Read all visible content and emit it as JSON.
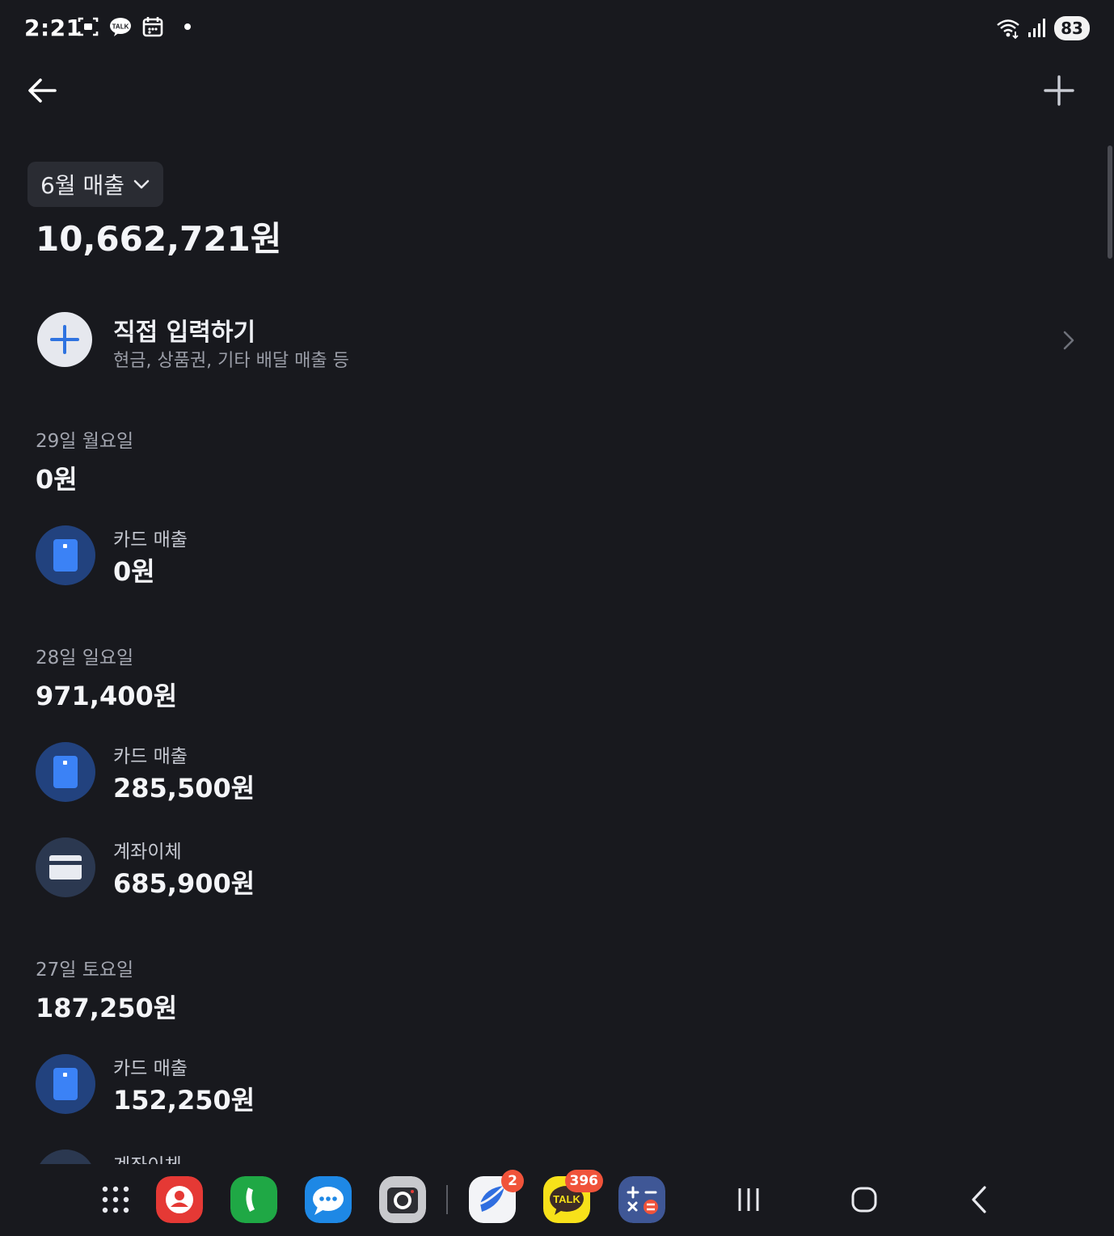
{
  "status_bar": {
    "time": "2:21",
    "left_icons": [
      "screenshot-icon",
      "kakaotalk-icon",
      "calendar-icon",
      "dot-icon"
    ],
    "right_icons": [
      "wifi-icon",
      "signal-icon"
    ],
    "battery": "83"
  },
  "header": {
    "back_icon": "arrow-left-icon",
    "add_icon": "plus-icon"
  },
  "summary": {
    "month_label": "6월 매출",
    "total": "10,662,721원"
  },
  "manual_input": {
    "title": "직접 입력하기",
    "subtitle": "현금, 상품권, 기타 배달 매출 등"
  },
  "days": [
    {
      "label": "29일 월요일",
      "total": "0원",
      "entries": [
        {
          "type": "card",
          "label": "카드 매출",
          "amount": "0원"
        }
      ]
    },
    {
      "label": "28일 일요일",
      "total": "971,400원",
      "entries": [
        {
          "type": "card",
          "label": "카드 매출",
          "amount": "285,500원"
        },
        {
          "type": "bank",
          "label": "계좌이체",
          "amount": "685,900원"
        }
      ]
    },
    {
      "label": "27일 토요일",
      "total": "187,250원",
      "entries": [
        {
          "type": "card",
          "label": "카드 매출",
          "amount": "152,250원"
        },
        {
          "type": "bank",
          "label": "계좌이체",
          "amount": ""
        }
      ]
    }
  ],
  "taskbar": {
    "apps": [
      {
        "name": "apps-grid-icon"
      },
      {
        "name": "contacts-icon",
        "color": "#e53935"
      },
      {
        "name": "phone-icon",
        "color": "#1fa845"
      },
      {
        "name": "messages-icon",
        "color": "#1e88e5"
      },
      {
        "name": "camera-icon",
        "color": "#c8c9cd"
      },
      {
        "name": "browser-icon",
        "badge": "2"
      },
      {
        "name": "kakaotalk-icon",
        "badge": "396",
        "color": "#f7e11a"
      },
      {
        "name": "calculator-icon",
        "color": "#3f5796"
      }
    ],
    "nav": [
      "recents-icon",
      "home-icon",
      "back-icon"
    ]
  },
  "colors": {
    "background": "#18191e",
    "card_icon_bg": "#22427e",
    "card_accent": "#3b82f6",
    "bank_icon_bg": "#2b3850",
    "badge": "#f0533a"
  }
}
